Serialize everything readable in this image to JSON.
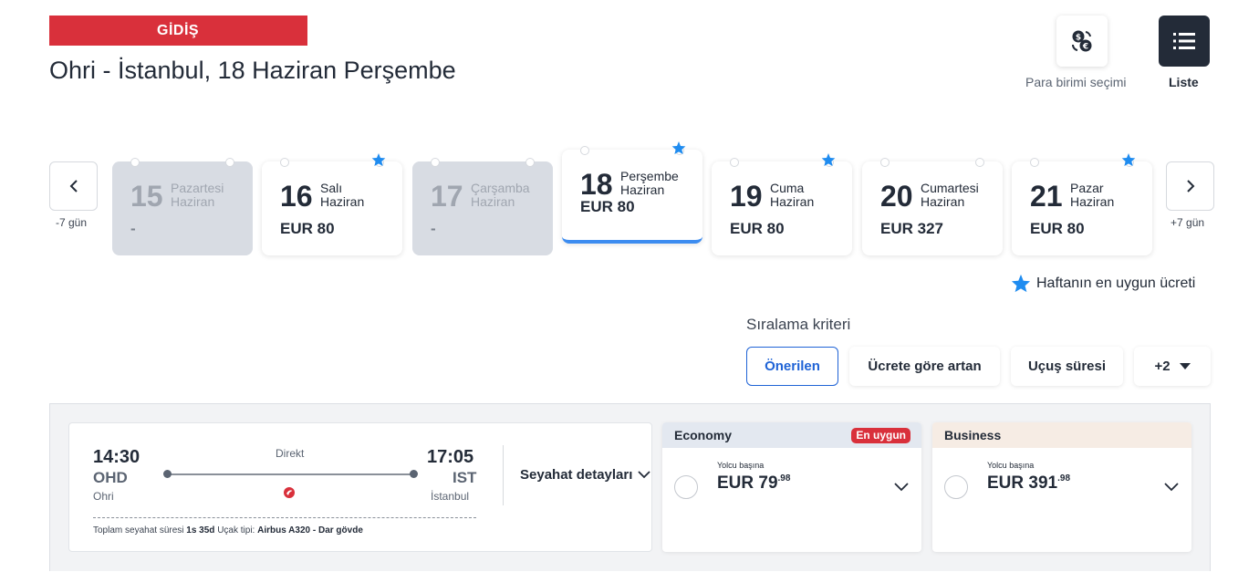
{
  "header": {
    "direction_label": "GİDİŞ",
    "title": "Ohri - İstanbul, 18 Haziran Perşembe"
  },
  "tools": {
    "currency_label": "Para birimi seçimi",
    "currency_icon": "currency-exchange-icon",
    "list_label": "Liste",
    "list_icon": "list-icon"
  },
  "date_nav": {
    "prev_label": "-7 gün",
    "next_label": "+7 gün",
    "days": [
      {
        "day": "15",
        "weekday": "Pazartesi",
        "month": "Haziran",
        "price": "-",
        "disabled": true,
        "best": false,
        "selected": false
      },
      {
        "day": "16",
        "weekday": "Salı",
        "month": "Haziran",
        "price": "EUR 80",
        "disabled": false,
        "best": true,
        "selected": false
      },
      {
        "day": "17",
        "weekday": "Çarşamba",
        "month": "Haziran",
        "price": "-",
        "disabled": true,
        "best": false,
        "selected": false
      },
      {
        "day": "18",
        "weekday": "Perşembe",
        "month": "Haziran",
        "price": "EUR 80",
        "disabled": false,
        "best": true,
        "selected": true
      },
      {
        "day": "19",
        "weekday": "Cuma",
        "month": "Haziran",
        "price": "EUR 80",
        "disabled": false,
        "best": true,
        "selected": false
      },
      {
        "day": "20",
        "weekday": "Cumartesi",
        "month": "Haziran",
        "price": "EUR 327",
        "disabled": false,
        "best": false,
        "selected": false
      },
      {
        "day": "21",
        "weekday": "Pazar",
        "month": "Haziran",
        "price": "EUR 80",
        "disabled": false,
        "best": true,
        "selected": false
      }
    ],
    "legend": "Haftanın en uygun ücreti"
  },
  "sort": {
    "title": "Sıralama kriteri",
    "options": [
      "Önerilen",
      "Ücrete göre artan",
      "Uçuş süresi",
      "+2"
    ],
    "active": "Önerilen"
  },
  "flight": {
    "departure_time": "14:30",
    "departure_code": "OHD",
    "departure_city": "Ohri",
    "arrival_time": "17:05",
    "arrival_code": "IST",
    "arrival_city": "İstanbul",
    "stop_type": "Direkt",
    "details_label": "Seyahat detayları",
    "total_duration_label": "Toplam seyahat süresi",
    "total_duration": "1s 35d",
    "aircraft_label": "Uçak tipi:",
    "aircraft": "Airbus A320 - Dar gövde"
  },
  "fares": {
    "economy": {
      "name": "Economy",
      "tag": "En uygun",
      "per": "Yolcu başına",
      "price_main": "EUR 79",
      "price_cents": ".98"
    },
    "business": {
      "name": "Business",
      "per": "Yolcu başına",
      "price_main": "EUR 391",
      "price_cents": ".98"
    }
  },
  "colors": {
    "brand_red": "#d9303b",
    "accent_blue": "#1f63d6",
    "star_blue": "#1f8cf0",
    "dark": "#232b38"
  }
}
